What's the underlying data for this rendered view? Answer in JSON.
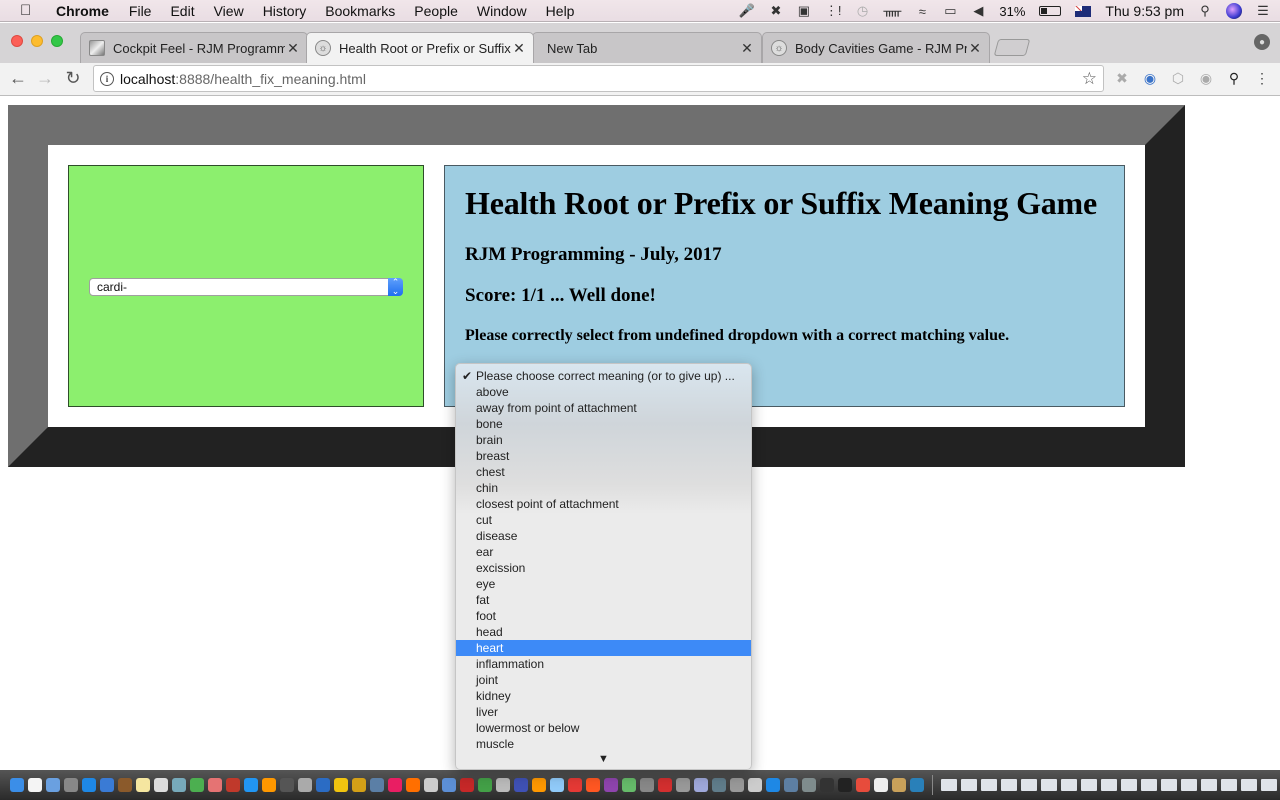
{
  "menubar": {
    "apple_icon": "apple-logo-icon",
    "app_name": "Chrome",
    "items": [
      "File",
      "Edit",
      "View",
      "History",
      "Bookmarks",
      "People",
      "Window",
      "Help"
    ],
    "status_icons": [
      "microphone-icon",
      "tool-icon",
      "audio-icon",
      "bars-icon",
      "time-machine-icon",
      "bluetooth-icon",
      "wifi-icon",
      "airplay-icon",
      "volume-icon"
    ],
    "battery_percent": "31%",
    "battery_level": 0.31,
    "input_source": "australia-flag-icon",
    "clock": "Thu 9:53 pm"
  },
  "browser": {
    "tabs": [
      {
        "title": "Cockpit Feel - RJM Programming",
        "active": false
      },
      {
        "title": "Health Root or Prefix or Suffix Meaning Game",
        "active": true
      },
      {
        "title": "New Tab",
        "active": false
      },
      {
        "title": "Body Cavities Game - RJM Programming",
        "active": false
      }
    ],
    "url_host": "localhost",
    "url_rest": ":8888/health_fix_meaning.html"
  },
  "game": {
    "root_select_value": "cardi-",
    "title": "Health Root or Prefix or Suffix Meaning Game",
    "subtitle": "RJM Programming - July, 2017",
    "score": "Score: 1/1 ... Well done!",
    "instruction": "Please correctly select from undefined dropdown with a correct matching value."
  },
  "meaning_dropdown": {
    "selected_index": 0,
    "highlighted_index": 17,
    "options": [
      "Please choose correct meaning (or to give up) ...",
      "above",
      "away from point of attachment",
      "bone",
      "brain",
      "breast",
      "chest",
      "chin",
      "closest point of attachment",
      "cut",
      "disease",
      "ear",
      "excission",
      "eye",
      "fat",
      "foot",
      "head",
      "heart",
      "inflammation",
      "joint",
      "kidney",
      "liver",
      "lowermost or below",
      "muscle"
    ],
    "more_below": true
  },
  "colors": {
    "left_panel": "#8cef6e",
    "right_panel": "#9ecde1",
    "frame_light": "#6f6f6f",
    "frame_dark": "#222222",
    "highlight": "#3d8af7"
  }
}
